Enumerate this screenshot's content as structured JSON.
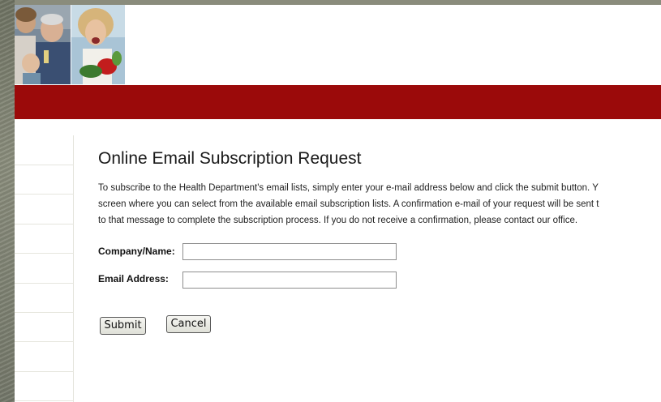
{
  "header": {
    "photos": [
      "family-photo",
      "woman-with-vegetables-photo"
    ],
    "banner_color": "#9b0a0a"
  },
  "sidebar": {
    "items": [
      "",
      "",
      "",
      "",
      "",
      "",
      "",
      "",
      ""
    ]
  },
  "main": {
    "title": "Online Email Subscription Request",
    "intro_lines": [
      "To subscribe to the Health Department's email lists, simply enter your e-mail address below and click the submit button. Y",
      "screen where you can select from the available email subscription lists. A confirmation e-mail of your request will be sent t",
      "to that message to complete the subscription process. If you do not receive a confirmation, please contact our office."
    ]
  },
  "form": {
    "company_label": "Company/Name:",
    "company_value": "",
    "email_label": "Email Address:",
    "email_value": "",
    "submit_label": "Submit",
    "cancel_label": "Cancel"
  }
}
